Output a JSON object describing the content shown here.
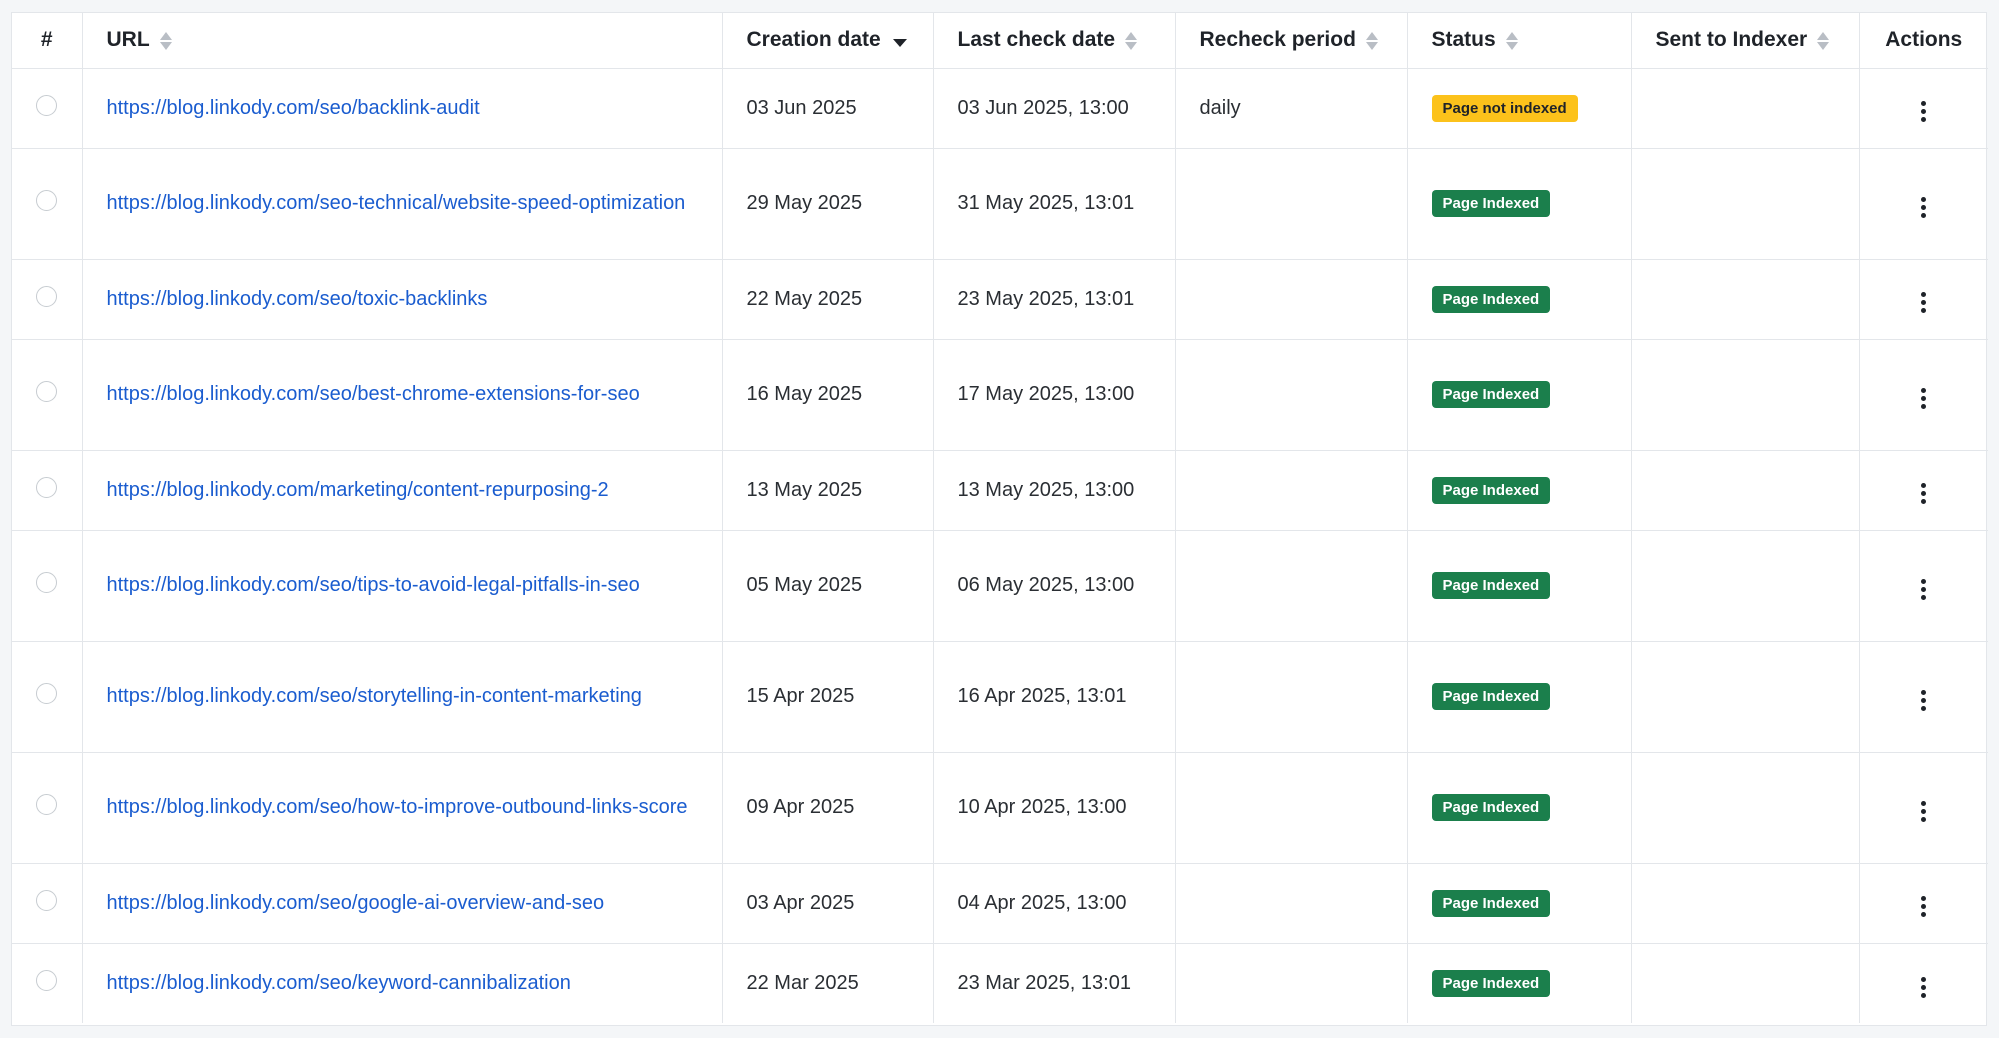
{
  "columns": {
    "num": "#",
    "url": "URL",
    "creation_date": "Creation date",
    "last_check_date": "Last check date",
    "recheck_period": "Recheck period",
    "status": "Status",
    "sent_to_indexer": "Sent to Indexer",
    "actions": "Actions"
  },
  "sort": {
    "column": "creation_date",
    "direction": "desc"
  },
  "colors": {
    "link": "#1a5ccf",
    "indexed_badge": "#1b7f4c",
    "not_indexed_badge": "#fcc21b"
  },
  "icons": {
    "row_select": "radio-icon",
    "row_actions": "kebab-menu-icon",
    "sort": "sort-icon"
  },
  "rows": [
    {
      "url": "https://blog.linkody.com/seo/backlink-audit",
      "creation_date": "03 Jun 2025",
      "last_check_date": "03 Jun 2025, 13:00",
      "recheck_period": "daily",
      "status": "Page not indexed",
      "status_type": "not-indexed",
      "sent_to_indexer": ""
    },
    {
      "url": "https://blog.linkody.com/seo-technical/website-speed-optimization",
      "creation_date": "29 May 2025",
      "last_check_date": "31 May 2025, 13:01",
      "recheck_period": "",
      "status": "Page Indexed",
      "status_type": "indexed",
      "sent_to_indexer": ""
    },
    {
      "url": "https://blog.linkody.com/seo/toxic-backlinks",
      "creation_date": "22 May 2025",
      "last_check_date": "23 May 2025, 13:01",
      "recheck_period": "",
      "status": "Page Indexed",
      "status_type": "indexed",
      "sent_to_indexer": ""
    },
    {
      "url": "https://blog.linkody.com/seo/best-chrome-extensions-for-seo",
      "creation_date": "16 May 2025",
      "last_check_date": "17 May 2025, 13:00",
      "recheck_period": "",
      "status": "Page Indexed",
      "status_type": "indexed",
      "sent_to_indexer": ""
    },
    {
      "url": "https://blog.linkody.com/marketing/content-repurposing-2",
      "creation_date": "13 May 2025",
      "last_check_date": "13 May 2025, 13:00",
      "recheck_period": "",
      "status": "Page Indexed",
      "status_type": "indexed",
      "sent_to_indexer": ""
    },
    {
      "url": "https://blog.linkody.com/seo/tips-to-avoid-legal-pitfalls-in-seo",
      "creation_date": "05 May 2025",
      "last_check_date": "06 May 2025, 13:00",
      "recheck_period": "",
      "status": "Page Indexed",
      "status_type": "indexed",
      "sent_to_indexer": ""
    },
    {
      "url": "https://blog.linkody.com/seo/storytelling-in-content-marketing",
      "creation_date": "15 Apr 2025",
      "last_check_date": "16 Apr 2025, 13:01",
      "recheck_period": "",
      "status": "Page Indexed",
      "status_type": "indexed",
      "sent_to_indexer": ""
    },
    {
      "url": "https://blog.linkody.com/seo/how-to-improve-outbound-links-score",
      "creation_date": "09 Apr 2025",
      "last_check_date": "10 Apr 2025, 13:00",
      "recheck_period": "",
      "status": "Page Indexed",
      "status_type": "indexed",
      "sent_to_indexer": ""
    },
    {
      "url": "https://blog.linkody.com/seo/google-ai-overview-and-seo",
      "creation_date": "03 Apr 2025",
      "last_check_date": "04 Apr 2025, 13:00",
      "recheck_period": "",
      "status": "Page Indexed",
      "status_type": "indexed",
      "sent_to_indexer": ""
    },
    {
      "url": "https://blog.linkody.com/seo/keyword-cannibalization",
      "creation_date": "22 Mar 2025",
      "last_check_date": "23 Mar 2025, 13:01",
      "recheck_period": "",
      "status": "Page Indexed",
      "status_type": "indexed",
      "sent_to_indexer": ""
    }
  ]
}
